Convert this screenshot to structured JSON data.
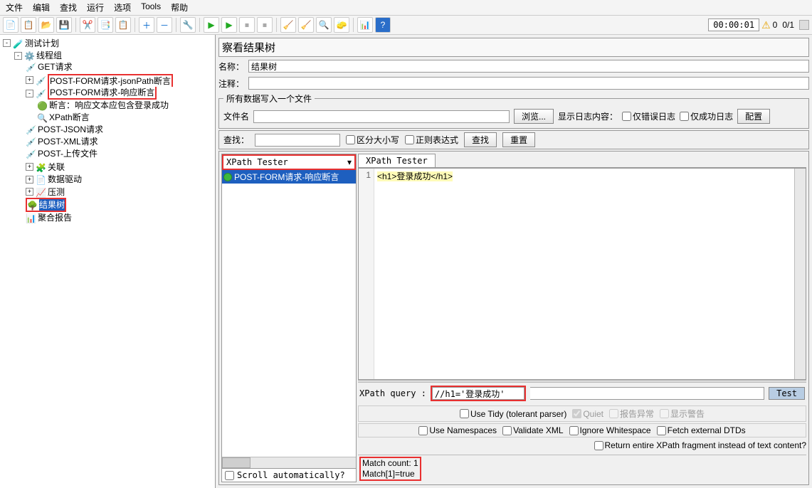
{
  "menu": {
    "file": "文件",
    "edit": "编辑",
    "search": "查找",
    "run": "运行",
    "options": "选项",
    "tools": "Tools",
    "help": "帮助"
  },
  "toolbar": {
    "timer": "00:00:01",
    "warn_count": "0",
    "run_count": "0/1"
  },
  "tree": {
    "root": "测试计划",
    "thread_group": "线程组",
    "items": [
      "GET请求",
      "POST-FORM请求-jsonPath断言",
      "POST-FORM请求-响应断言",
      "断言：响应文本应包含登录成功",
      "XPath断言",
      "POST-JSON请求",
      "POST-XML请求",
      "POST-上传文件",
      "关联",
      "数据驱动",
      "压测",
      "结果树",
      "聚合报告"
    ]
  },
  "panel": {
    "title": "察看结果树",
    "name_label": "名称：",
    "name_value": "结果树",
    "comment_label": "注释：",
    "file_legend": "所有数据写入一个文件",
    "filename_label": "文件名",
    "browse": "浏览...",
    "log_label": "显示日志内容：",
    "only_error": "仅错误日志",
    "only_success": "仅成功日志",
    "config": "配置"
  },
  "search": {
    "label": "查找：",
    "case": "区分大小写",
    "regex": "正则表达式",
    "find": "查找",
    "reset": "重置"
  },
  "combo": {
    "value": "XPath Tester"
  },
  "result_list": {
    "item0": "POST-FORM请求-响应断言"
  },
  "tabs": {
    "xpath": "XPath Tester"
  },
  "code": {
    "line1_num": "1",
    "line1": "<h1>登录成功</h1>"
  },
  "xpath": {
    "label": "XPath query :",
    "value": "//h1='登录成功'",
    "test": "Test",
    "use_tidy": "Use Tidy (tolerant parser)",
    "quiet": "Quiet",
    "report_err": "报告异常",
    "show_warn": "显示警告",
    "use_ns": "Use Namespaces",
    "validate": "Validate XML",
    "ignore_ws": "Ignore Whitespace",
    "fetch_dtd": "Fetch external DTDs",
    "return_frag": "Return entire XPath fragment instead of text content?"
  },
  "match": {
    "count": "Match count: 1",
    "result": "Match[1]=true"
  },
  "scroll_auto": "Scroll automatically?"
}
